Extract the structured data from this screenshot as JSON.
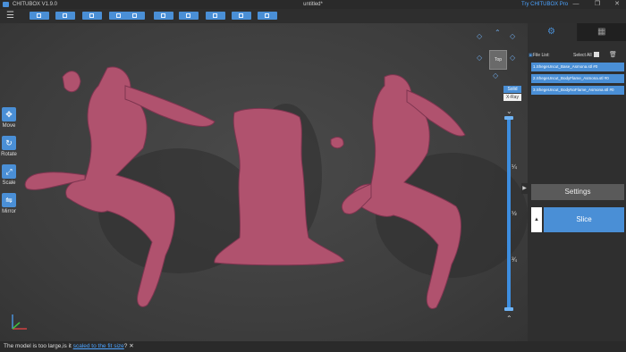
{
  "titlebar": {
    "app_name": "CHITUBOX V1.9.0",
    "document": "untitled*",
    "promo": "Try CHITUBOX Pro",
    "minimize": "—",
    "maximize": "❐",
    "close": "✕"
  },
  "toolbar": {
    "menu_icon": "hamburger-icon",
    "buttons": [
      "open-file-icon",
      "open-project-icon",
      "save-icon",
      "undo-icon",
      "settings-icon",
      "support-icon",
      "hollow-icon",
      "fill-icon",
      "print-icon"
    ]
  },
  "left_tools": [
    {
      "label": "Move",
      "icon": "move-icon"
    },
    {
      "label": "Rotate",
      "icon": "rotate-icon"
    },
    {
      "label": "Scale",
      "icon": "scale-icon"
    },
    {
      "label": "Mirror",
      "icon": "mirror-icon"
    }
  ],
  "viewcube": {
    "face": "Top"
  },
  "view_modes": {
    "solid": "Solid",
    "xray": "X-Ray"
  },
  "layer_slider": {
    "ticks": [
      "¼",
      "½",
      "¾"
    ]
  },
  "panel": {
    "file_list_label": "File List:",
    "select_all_label": "Select All",
    "files": [
      "1.ShegeUncut_Base_Asmona.stl #0",
      "2.ShegeUncut_BodyFlame_Asmona.stl #0",
      "3.ShegeUncut_BodyNoFlame_Asmona.stl #0"
    ],
    "settings_label": "Settings",
    "slice_label": "Slice",
    "slice_side": "▲"
  },
  "status": {
    "message": "The model is too large,is it ",
    "link": "scaled to the fit size",
    "suffix": "? ✕"
  },
  "colors": {
    "accent": "#4a8fd6",
    "model": "#b0526e"
  }
}
